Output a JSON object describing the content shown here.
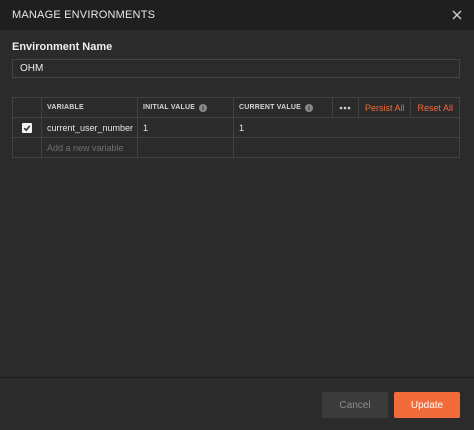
{
  "modal": {
    "title": "MANAGE ENVIRONMENTS",
    "close_icon": "close-icon"
  },
  "environment": {
    "label": "Environment Name",
    "value": "OHM"
  },
  "table": {
    "headers": {
      "variable": "VARIABLE",
      "initial_value": "INITIAL VALUE",
      "current_value": "CURRENT VALUE"
    },
    "actions": {
      "more_icon": "more-horizontal-icon",
      "persist_all": "Persist All",
      "reset_all": "Reset All"
    },
    "rows": [
      {
        "checked": true,
        "variable": "current_user_number",
        "initial_value": "1",
        "current_value": "1"
      }
    ],
    "new_row_placeholder": "Add a new variable"
  },
  "footer": {
    "cancel_label": "Cancel",
    "update_label": "Update"
  },
  "colors": {
    "accent": "#f26b3a",
    "header_bg": "#1f1f1f",
    "body_bg": "#2b2b2b"
  }
}
